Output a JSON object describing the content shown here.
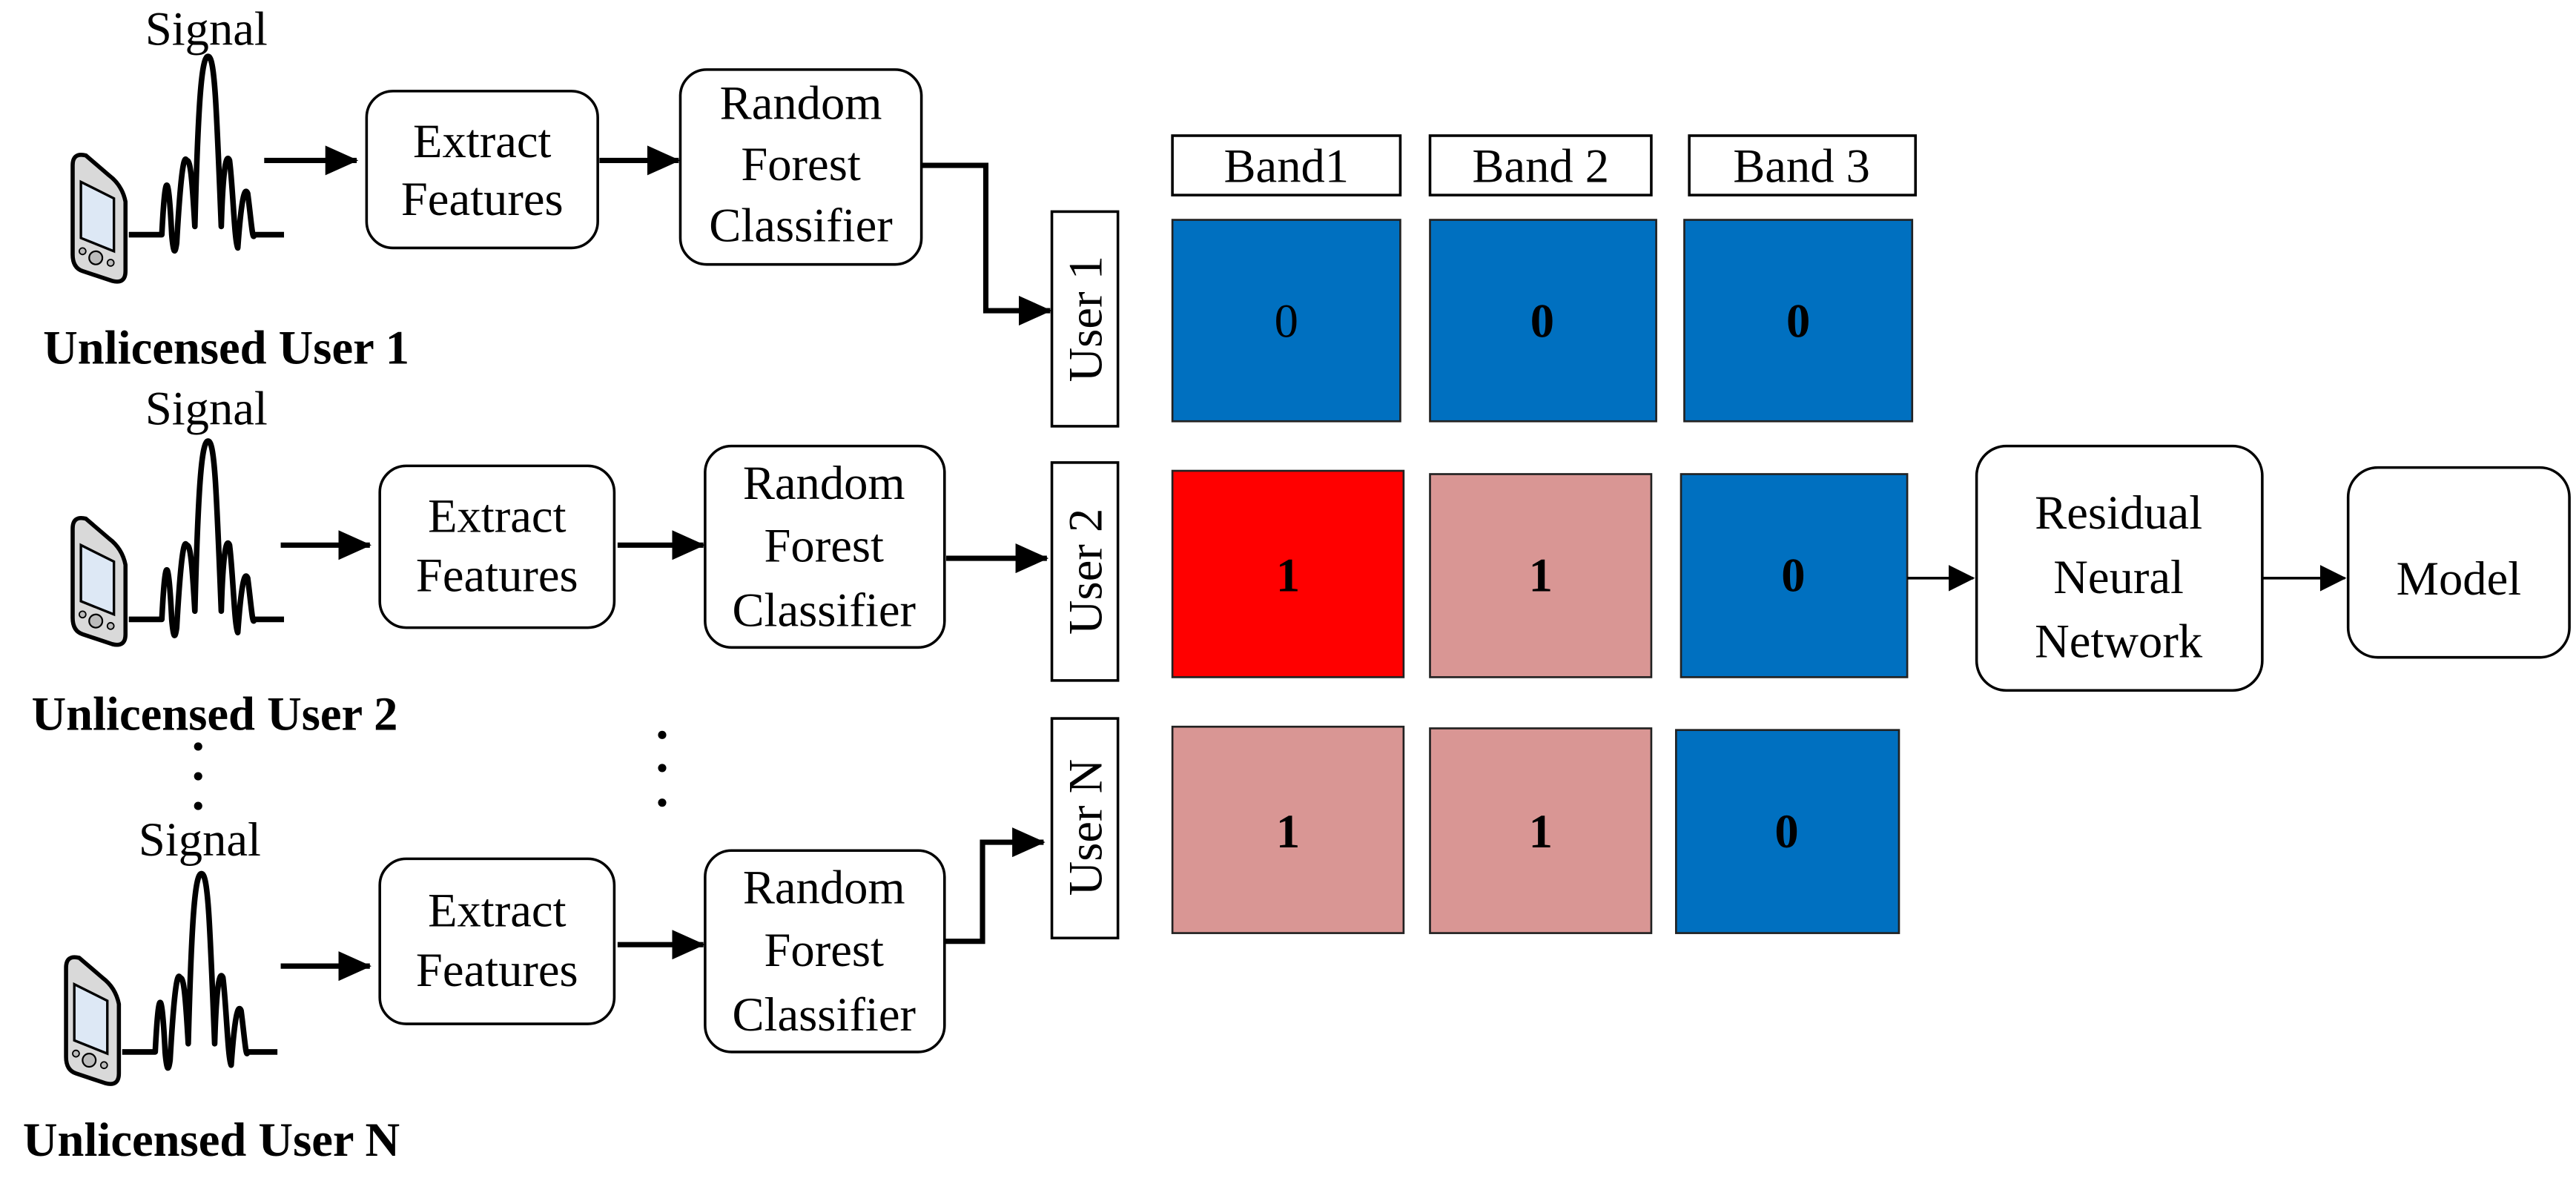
{
  "users": [
    {
      "signal_label": "Signal",
      "name": "Unlicensed User 1",
      "extract_label": [
        "Extract",
        "Features"
      ],
      "classifier_label": [
        "Random",
        "Forest",
        "Classifier"
      ],
      "row_label": "User 1"
    },
    {
      "signal_label": "Signal",
      "name": "Unlicensed User 2",
      "extract_label": [
        "Extract",
        "Features"
      ],
      "classifier_label": [
        "Random",
        "Forest",
        "Classifier"
      ],
      "row_label": "User 2"
    },
    {
      "signal_label": "Signal",
      "name": "Unlicensed User N",
      "extract_label": [
        "Extract",
        "Features"
      ],
      "classifier_label": [
        "Random",
        "Forest",
        "Classifier"
      ],
      "row_label": "User N"
    }
  ],
  "bands": [
    "Band1",
    "Band 2",
    "Band 3"
  ],
  "matrix": [
    [
      "0",
      "0",
      "0"
    ],
    [
      "1",
      "1",
      "0"
    ],
    [
      "1",
      "1",
      "0"
    ]
  ],
  "cell_colors": [
    [
      "#0070C0",
      "#0070C0",
      "#0070C0"
    ],
    [
      "#FF0000",
      "#D99694",
      "#0070C0"
    ],
    [
      "#D99694",
      "#D99694",
      "#0070C0"
    ]
  ],
  "network_label": [
    "Residual",
    "Neural",
    "Network"
  ],
  "model_label": "Model",
  "icons": {
    "device": "pda-phone-icon",
    "signal": "sinc-waveform-icon"
  }
}
